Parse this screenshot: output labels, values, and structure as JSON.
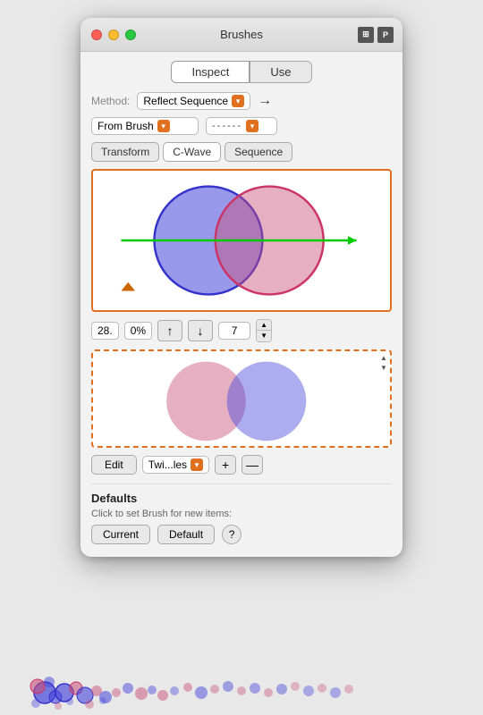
{
  "window": {
    "title": "Brushes",
    "tabs": [
      {
        "label": "Inspect",
        "active": true
      },
      {
        "label": "Use",
        "active": false
      }
    ],
    "icons": [
      {
        "name": "layout-icon",
        "symbol": "⊞"
      },
      {
        "name": "plugin-icon",
        "symbol": "P"
      }
    ]
  },
  "method": {
    "label": "Method:",
    "value": "Reflect Sequence",
    "arrow": "→"
  },
  "from_brush": {
    "label": "From Brush",
    "dash_value": "------"
  },
  "mode_buttons": [
    {
      "label": "Transform",
      "active": false
    },
    {
      "label": "C-Wave",
      "active": true
    },
    {
      "label": "Sequence",
      "active": false
    }
  ],
  "controls": {
    "number_label": "28.",
    "percent_label": "0%",
    "up_arrow": "↑",
    "down_arrow": "↓",
    "value": "7"
  },
  "edit_row": {
    "edit_label": "Edit",
    "brush_name": "Twi...les",
    "add_label": "+",
    "minus_label": "—"
  },
  "defaults": {
    "title": "Defaults",
    "description": "Click to set Brush for new items:",
    "current_label": "Current",
    "default_label": "Default",
    "help_label": "?"
  }
}
